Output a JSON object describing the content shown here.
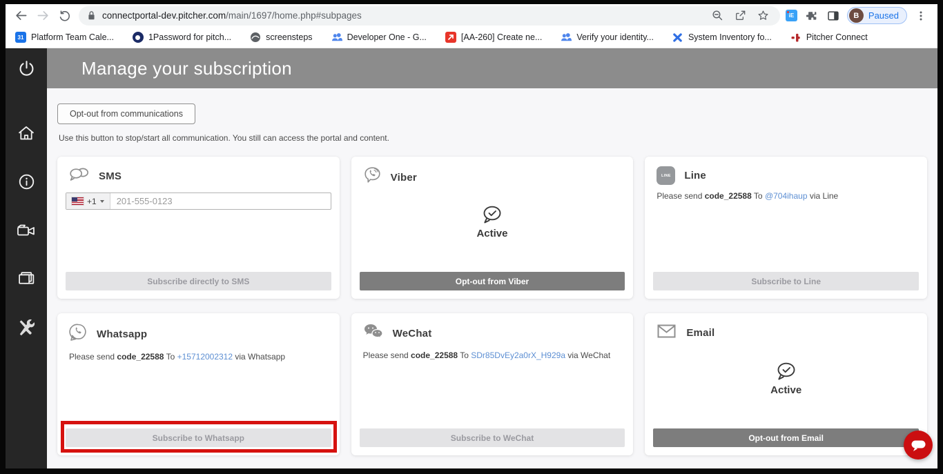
{
  "browser": {
    "url": {
      "domain": "connectportal-dev.pitcher.com",
      "path": "/main/1697/home.php#subpages"
    },
    "profile": {
      "initial": "B",
      "status": "Paused"
    },
    "bookmarks": [
      {
        "icon": "calendar-icon",
        "label": "Platform Team Cale..."
      },
      {
        "icon": "1password-icon",
        "label": "1Password for pitch..."
      },
      {
        "icon": "globe-icon",
        "label": "screensteps"
      },
      {
        "icon": "people-icon",
        "label": "Developer One - G..."
      },
      {
        "icon": "jira-arrow-icon",
        "label": "[AA-260] Create ne..."
      },
      {
        "icon": "people-icon",
        "label": "Verify your identity..."
      },
      {
        "icon": "x-icon",
        "label": "System Inventory fo..."
      },
      {
        "icon": "pitcher-plus-icon",
        "label": "Pitcher Connect"
      }
    ]
  },
  "sidebar": {
    "items": [
      "power-icon",
      "home-icon",
      "info-icon",
      "video-camera-icon",
      "layers-icon",
      "tools-icon"
    ]
  },
  "header": {
    "title": "Manage your subscription"
  },
  "optout": {
    "button_label": "Opt-out from communications",
    "description": "Use this button to stop/start all communication. You still can access the portal and content."
  },
  "cards": [
    {
      "title": "SMS",
      "icon": "sms-bubbles-icon",
      "dial_code": "+1",
      "phone_placeholder": "201-555-0123",
      "button_label": "Subscribe directly to SMS",
      "button_style": "light"
    },
    {
      "title": "Viber",
      "icon": "viber-icon",
      "status": "Active",
      "button_label": "Opt-out from Viber",
      "button_style": "dark"
    },
    {
      "title": "Line",
      "icon": "line-icon",
      "icon_text": "LINE",
      "msg": {
        "prefix": "Please send",
        "code": "code_22588",
        "to": "To",
        "link": "@704ihaup",
        "via": "via Line"
      },
      "button_label": "Subscribe to Line",
      "button_style": "light"
    },
    {
      "title": "Whatsapp",
      "icon": "whatsapp-icon",
      "msg": {
        "prefix": "Please send",
        "code": "code_22588",
        "to": "To",
        "link": "+15712002312",
        "via": "via Whatsapp"
      },
      "button_label": "Subscribe to Whatsapp",
      "button_style": "light",
      "highlighted": true
    },
    {
      "title": "WeChat",
      "icon": "wechat-icon",
      "msg": {
        "prefix": "Please send",
        "code": "code_22588",
        "to": "To",
        "link": "SDr85DvEy2a0rX_H929a",
        "via": "via WeChat"
      },
      "button_label": "Subscribe to WeChat",
      "button_style": "light"
    },
    {
      "title": "Email",
      "icon": "email-icon",
      "status": "Active",
      "button_label": "Opt-out from Email",
      "button_style": "dark"
    }
  ],
  "colors": {
    "header_gray": "#8c8c8c",
    "sidebar_dark": "#262626",
    "highlight_red": "#d6120f",
    "link_blue": "#5d8fd3",
    "chat_fab_red": "#cb0e10",
    "active_button_gray": "#7d7d7d",
    "disabled_button_gray": "#e3e3e5"
  }
}
